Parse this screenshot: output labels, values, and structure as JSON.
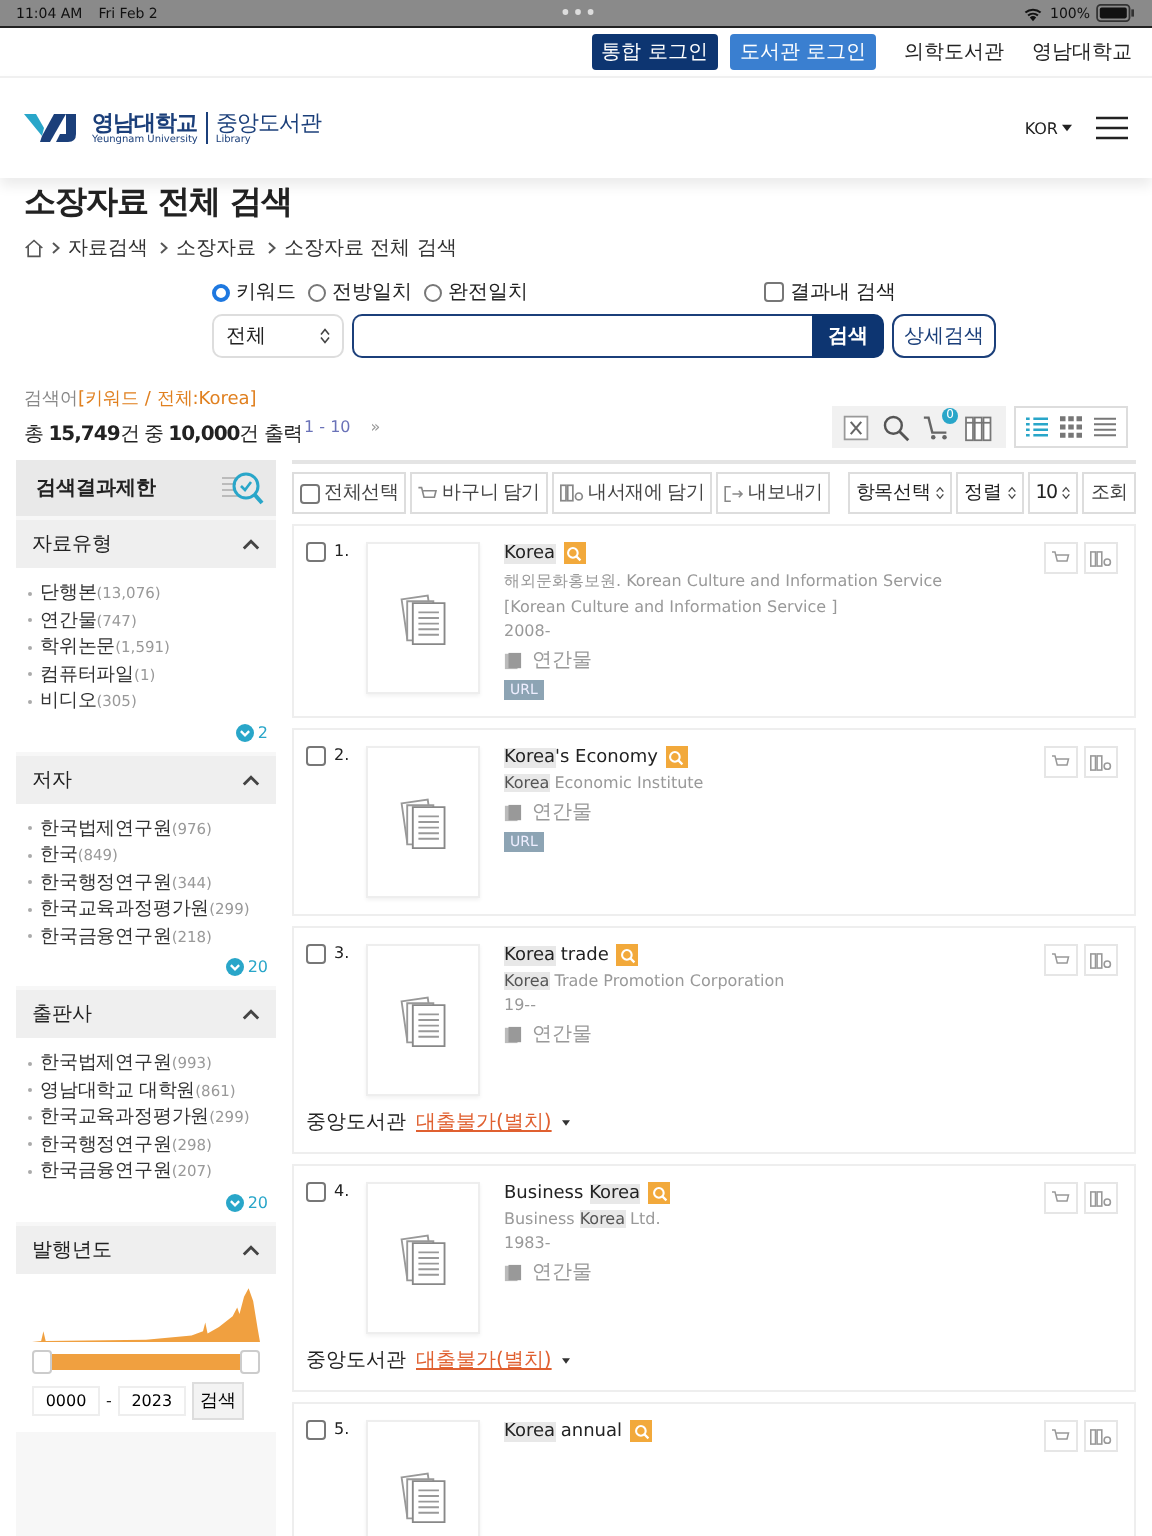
{
  "status_bar": {
    "time": "11:04 AM",
    "date": "Fri Feb 2",
    "battery": "100%"
  },
  "top_links": {
    "buttons": [
      {
        "label": "통합 로그인",
        "kind": "primary"
      },
      {
        "label": "도서관 로그인",
        "kind": "secondary"
      }
    ],
    "links": [
      "의학도서관",
      "영남대학교"
    ]
  },
  "header": {
    "logo_name": "영남대학교",
    "logo_name_en": "Yeungnam University",
    "logo_library": "중앙도서관",
    "logo_library_en": "Library",
    "language": "KOR"
  },
  "page_title": "소장자료 전체 검색",
  "breadcrumb": [
    "자료검색",
    "소장자료",
    "소장자료 전체 검색"
  ],
  "search": {
    "modes": [
      {
        "label": "키워드",
        "selected": true
      },
      {
        "label": "전방일치",
        "selected": false
      },
      {
        "label": "완전일치",
        "selected": false
      }
    ],
    "within_results": {
      "label": "결과내 검색",
      "checked": false
    },
    "scope": "전체",
    "button": "검색",
    "advanced": "상세검색"
  },
  "summary": {
    "query_label": "검색어",
    "query": "[키워드 / 전체:Korea]",
    "count": "총 **15,749**건 중 **10,000**건 출력",
    "range": "1 - 10",
    "next": "»",
    "cart_count": "0",
    "views": [
      {
        "kind": "list",
        "selected": true
      },
      {
        "kind": "grid",
        "selected": false
      },
      {
        "kind": "lines",
        "selected": false
      }
    ]
  },
  "sidebar": {
    "title": "검색결과제한",
    "facets": [
      {
        "title": "자료유형",
        "expanded": true,
        "items": [
          {
            "label": "단행본",
            "count": "(13,076)"
          },
          {
            "label": "연간물",
            "count": "(747)"
          },
          {
            "label": "학위논문",
            "count": "(1,591)"
          },
          {
            "label": "컴퓨터파일",
            "count": "(1)"
          },
          {
            "label": "비디오",
            "count": "(305)"
          }
        ],
        "more": "2"
      },
      {
        "title": "저자",
        "expanded": true,
        "items": [
          {
            "label": "한국법제연구원",
            "count": "(976)"
          },
          {
            "label": "한국",
            "count": "(849)"
          },
          {
            "label": "한국행정연구원",
            "count": "(344)"
          },
          {
            "label": "한국교육과정평가원",
            "count": "(299)"
          },
          {
            "label": "한국금융연구원",
            "count": "(218)"
          }
        ],
        "more": "20"
      },
      {
        "title": "출판사",
        "expanded": true,
        "items": [
          {
            "label": "한국법제연구원",
            "count": "(993)"
          },
          {
            "label": "영남대학교 대학원",
            "count": "(861)"
          },
          {
            "label": "한국교육과정평가원",
            "count": "(299)"
          },
          {
            "label": "한국행정연구원",
            "count": "(298)"
          },
          {
            "label": "한국금융연구원",
            "count": "(207)"
          }
        ],
        "more": "20"
      }
    ],
    "year": {
      "title": "발행년도",
      "expanded": true,
      "level": 1,
      "from": "0000",
      "separator": "-",
      "to": "2023",
      "button": "검색"
    }
  },
  "toolbar": {
    "select_all": {
      "label": "전체선택",
      "checked": false
    },
    "actions": [
      {
        "label": "바구니 담기",
        "kind": "cart"
      },
      {
        "label": "내서재에 담기",
        "kind": "library"
      },
      {
        "label": "내보내기",
        "kind": "export"
      }
    ],
    "selects": [
      "항목선택",
      "정렬",
      "10"
    ],
    "submit": "조회"
  },
  "results": [
    {
      "number": "1.",
      "checked": false,
      "title": [
        {
          "text": "Korea",
          "highlight": true
        }
      ],
      "lines": [
        [
          {
            "text": "해외문화홍보원. Korean Culture and Information Service",
            "highlight": false
          }
        ],
        [
          {
            "text": "[Korean Culture and Information Service ]",
            "highlight": false
          }
        ],
        [
          {
            "text": "2008-",
            "highlight": false
          }
        ]
      ],
      "type": "연간물",
      "url": "URL"
    },
    {
      "number": "2.",
      "checked": false,
      "title": [
        {
          "text": "Korea",
          "highlight": true
        },
        {
          "text": "'s Economy",
          "highlight": false
        }
      ],
      "lines": [
        [
          {
            "text": "Korea",
            "highlight": true
          },
          {
            "text": " Economic Institute",
            "highlight": false
          }
        ]
      ],
      "type": "연간물",
      "url": "URL"
    },
    {
      "number": "3.",
      "checked": false,
      "title": [
        {
          "text": "Korea",
          "highlight": true
        },
        {
          "text": " trade",
          "highlight": false
        }
      ],
      "lines": [
        [
          {
            "text": "Korea",
            "highlight": true
          },
          {
            "text": " Trade Promotion Corporation",
            "highlight": false
          }
        ],
        [
          {
            "text": "19--",
            "highlight": false
          }
        ]
      ],
      "type": "연간물",
      "holding": {
        "library": "중앙도서관",
        "status": "대출불가(별치)"
      }
    },
    {
      "number": "4.",
      "checked": false,
      "title": [
        {
          "text": "Business ",
          "highlight": false
        },
        {
          "text": "Korea",
          "highlight": true
        }
      ],
      "lines": [
        [
          {
            "text": "Business ",
            "highlight": false
          },
          {
            "text": "Korea",
            "highlight": true
          },
          {
            "text": " Ltd.",
            "highlight": false
          }
        ],
        [
          {
            "text": "1983-",
            "highlight": false
          }
        ]
      ],
      "type": "연간물",
      "holding": {
        "library": "중앙도서관",
        "status": "대출불가(별치)"
      }
    },
    {
      "number": "5.",
      "checked": false,
      "title": [
        {
          "text": "Korea",
          "highlight": true
        },
        {
          "text": " annual",
          "highlight": false
        }
      ]
    }
  ]
}
